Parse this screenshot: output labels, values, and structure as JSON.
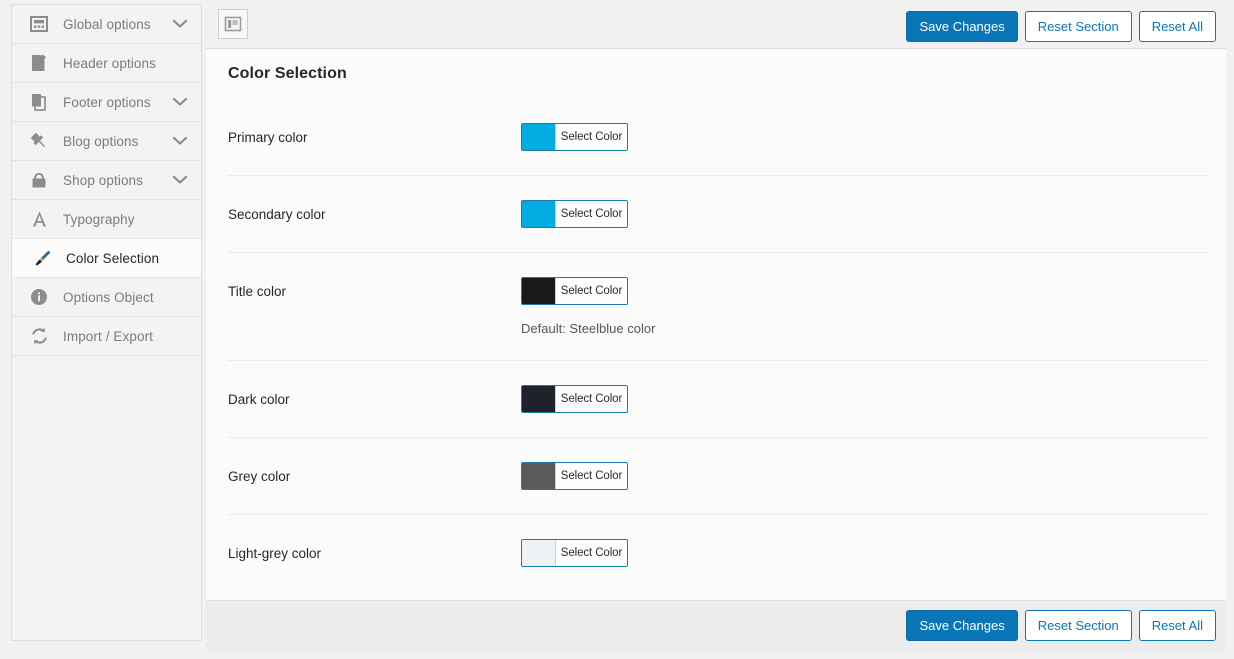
{
  "sidebar": {
    "items": [
      {
        "label": "Global options",
        "icon": "window-layout-icon",
        "chevron": true,
        "active": false
      },
      {
        "label": "Header options",
        "icon": "page-header-icon",
        "chevron": false,
        "active": false
      },
      {
        "label": "Footer options",
        "icon": "pages-stack-icon",
        "chevron": true,
        "active": false
      },
      {
        "label": "Blog options",
        "icon": "pushpin-icon",
        "chevron": true,
        "active": false
      },
      {
        "label": "Shop options",
        "icon": "shopping-bag-icon",
        "chevron": true,
        "active": false
      },
      {
        "label": "Typography",
        "icon": "letter-a-icon",
        "chevron": false,
        "active": false
      },
      {
        "label": "Color Selection",
        "icon": "paintbrush-icon",
        "chevron": false,
        "active": true
      },
      {
        "label": "Options Object",
        "icon": "info-circle-icon",
        "chevron": false,
        "active": false
      },
      {
        "label": "Import / Export",
        "icon": "sync-arrows-icon",
        "chevron": false,
        "active": false
      }
    ]
  },
  "toolbar": {
    "panel_toggle_icon": "expand-panel-icon",
    "save_label": "Save Changes",
    "reset_section_label": "Reset Section",
    "reset_all_label": "Reset All"
  },
  "main": {
    "section_title": "Color Selection",
    "fields": [
      {
        "label": "Primary color",
        "button_label": "Select Color",
        "swatch_color": "#00ace0",
        "description": ""
      },
      {
        "label": "Secondary color",
        "button_label": "Select Color",
        "swatch_color": "#00ace0",
        "description": ""
      },
      {
        "label": "Title color",
        "button_label": "Select Color",
        "swatch_color": "#191919",
        "description": "Default: Steelblue color"
      },
      {
        "label": "Dark color",
        "button_label": "Select Color",
        "swatch_color": "#1f222b",
        "description": ""
      },
      {
        "label": "Grey color",
        "button_label": "Select Color",
        "swatch_color": "#5a5a5a",
        "description": ""
      },
      {
        "label": "Light-grey color",
        "button_label": "Select Color",
        "swatch_color": "#eff2f5",
        "description": ""
      }
    ]
  },
  "footer": {
    "save_label": "Save Changes",
    "reset_section_label": "Reset Section",
    "reset_all_label": "Reset All"
  },
  "theme": {
    "accent": "#0b76b7",
    "sidebar_bg": "#f3f3f3",
    "panel_bg": "#fbfbfb",
    "footer_bg": "#ececec"
  }
}
